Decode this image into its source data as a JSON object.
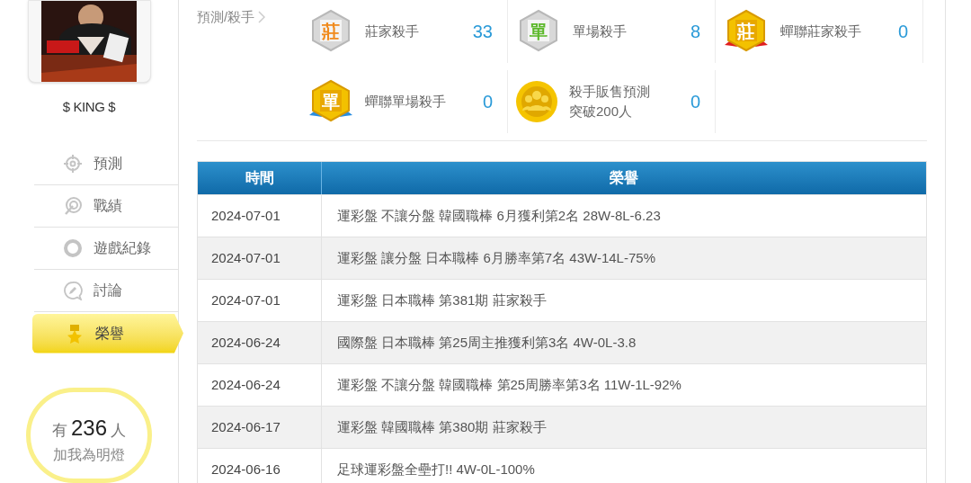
{
  "profile": {
    "name": "$ KING $"
  },
  "nav": [
    {
      "label": "預測",
      "kind": "target",
      "selected": false
    },
    {
      "label": "戰績",
      "kind": "spiral",
      "selected": false
    },
    {
      "label": "遊戲紀錄",
      "kind": "ring",
      "selected": false
    },
    {
      "label": "討論",
      "kind": "chat",
      "selected": false
    },
    {
      "label": "榮譽",
      "kind": "medal",
      "selected": true
    }
  ],
  "fans": {
    "prefix": "有",
    "count": "236",
    "suffix": "人",
    "caption": "加我為明燈"
  },
  "breadcrumb": "預測/殺手",
  "achievements": [
    {
      "kind": "silver",
      "glyph": "莊",
      "color": "#f08a1c",
      "label": [
        "莊家殺手"
      ],
      "count": "33"
    },
    {
      "kind": "silver",
      "glyph": "單",
      "color": "#5cb82a",
      "label": [
        "單場殺手"
      ],
      "count": "8"
    },
    {
      "kind": "gold-red",
      "glyph": "莊",
      "color": "#ffffff",
      "label": [
        "蟬聯莊家殺手"
      ],
      "count": "0"
    },
    {
      "kind": "gold-blue",
      "glyph": "單",
      "color": "#ffffff",
      "label": [
        "蟬聯單場殺手"
      ],
      "count": "0"
    },
    {
      "kind": "coin",
      "label": [
        "殺手販售預測",
        "突破200人"
      ],
      "count": "0"
    }
  ],
  "table": {
    "columns": [
      "時間",
      "榮譽"
    ],
    "rows": [
      [
        "2024-07-01",
        "運彩盤 不讓分盤 韓國職棒 6月獲利第2名 28W-8L-6.23"
      ],
      [
        "2024-07-01",
        "運彩盤 讓分盤 日本職棒 6月勝率第7名 43W-14L-75%"
      ],
      [
        "2024-07-01",
        "運彩盤 日本職棒 第381期 莊家殺手"
      ],
      [
        "2024-06-24",
        "國際盤 日本職棒 第25周主推獲利第3名 4W-0L-3.8"
      ],
      [
        "2024-06-24",
        "運彩盤 不讓分盤 韓國職棒 第25周勝率第3名 11W-1L-92%"
      ],
      [
        "2024-06-17",
        "運彩盤 韓國職棒 第380期 莊家殺手"
      ],
      [
        "2024-06-16",
        "足球運彩盤全壘打!! 4W-0L-100%"
      ]
    ]
  }
}
